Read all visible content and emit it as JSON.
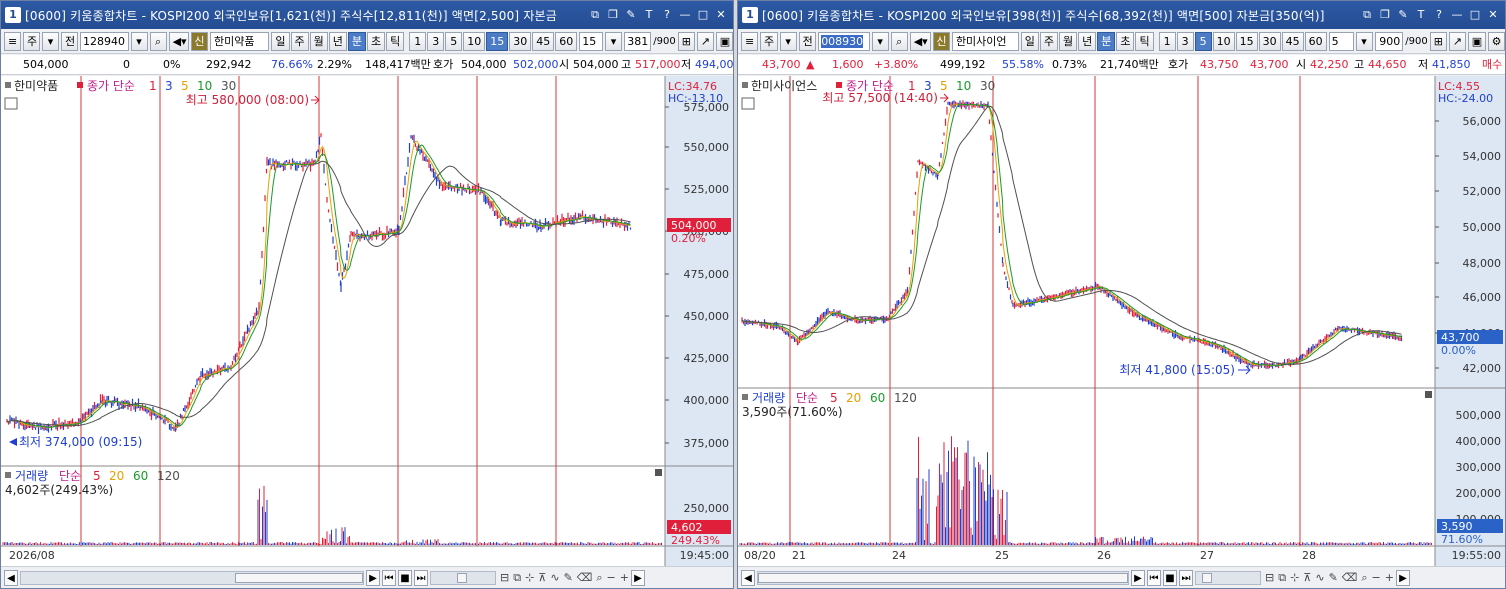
{
  "left": {
    "title": "[0600] 키움종합차트 - KOSPI200 외국인보유[1,621(천)] 주식수[12,811(천)] 액면[2,500] 자본금",
    "toolbar": {
      "market": "주",
      "prev": "전",
      "code": "128940",
      "badge": "신",
      "name": "한미약품",
      "periods": [
        "일",
        "주",
        "월",
        "년",
        "분",
        "초",
        "틱"
      ],
      "selected_period": "분",
      "intervals": [
        "1",
        "3",
        "5",
        "10",
        "15",
        "30",
        "45",
        "60"
      ],
      "selected_interval": "15",
      "interval_value": "15",
      "count": "381",
      "count_max": "/900"
    },
    "quote": {
      "price": "504,000",
      "change": "0",
      "change_pct": "0%",
      "volume": "292,942",
      "vol_ratio": "76.66%",
      "turnover": "2.29%",
      "amount": "148,417백만",
      "bid_label": "호가",
      "bid1": "504,000",
      "bid2": "502,000",
      "open_label": "시",
      "open": "504,000",
      "high_label": "고",
      "high": "517,000",
      "low_label": "저",
      "low": "494,000"
    },
    "chart": {
      "stock_label": "한미약품",
      "legend_prefix": "종가 단순",
      "legend_ma": [
        "1",
        "3",
        "5",
        "10",
        "30"
      ],
      "max_label": "최고 580,000 (08:00)",
      "min_label": "최저 374,000 (09:15)",
      "lc": "LC:34.76",
      "hc": "HC:-13.10",
      "price_ticks": [
        "575,000",
        "550,000",
        "525,000",
        "500,000",
        "475,000",
        "450,000",
        "425,000",
        "400,000",
        "375,000"
      ],
      "current_price": "504,000",
      "current_pct": "0.20%",
      "volume_label": "거래량",
      "volume_legend_prefix": "단순",
      "volume_ma": [
        "5",
        "20",
        "60",
        "120"
      ],
      "volume_info": "4,602주(249.43%)",
      "volume_tick": "250,000",
      "current_volume": "4,602",
      "current_volume_pct": "249.43%",
      "date_label": "2026/08",
      "time_label": "19:45:00"
    }
  },
  "right": {
    "title": "[0600] 키움종합차트 - KOSPI200 외국인보유[398(천)] 주식수[68,392(천)] 액면[500] 자본금[350(억)]",
    "toolbar": {
      "market": "주",
      "prev": "전",
      "code": "008930",
      "badge": "신",
      "name": "한미사이언",
      "periods": [
        "일",
        "주",
        "월",
        "년",
        "분",
        "초",
        "틱"
      ],
      "selected_period": "분",
      "intervals": [
        "1",
        "3",
        "5",
        "10",
        "15",
        "30",
        "45",
        "60"
      ],
      "selected_interval": "5",
      "interval_value": "5",
      "count": "900",
      "count_max": "/900"
    },
    "quote": {
      "price": "43,700",
      "change": "1,600",
      "change_pct": "+3.80%",
      "volume": "499,192",
      "vol_ratio": "55.58%",
      "turnover": "0.73%",
      "amount": "21,740백만",
      "bid_label": "호가",
      "bid1": "43,750",
      "bid2": "43,700",
      "open_label": "시",
      "open": "42,250",
      "high_label": "고",
      "high": "44,650",
      "low_label": "저",
      "low": "41,850",
      "extra": "매수"
    },
    "chart": {
      "stock_label": "한미사이언스",
      "legend_prefix": "종가 단순",
      "legend_ma": [
        "1",
        "3",
        "5",
        "10",
        "30"
      ],
      "max_label": "최고 57,500 (14:40)",
      "min_label": "최저 41,800 (15:05)",
      "lc": "LC:4.55",
      "hc": "HC:-24.00",
      "price_ticks": [
        "56,000",
        "54,000",
        "52,000",
        "50,000",
        "48,000",
        "46,000",
        "44,000",
        "42,000"
      ],
      "current_price": "43,700",
      "current_pct": "0.00%",
      "volume_label": "거래량",
      "volume_legend_prefix": "단순",
      "volume_ma": [
        "5",
        "20",
        "60",
        "120"
      ],
      "volume_info": "3,590주(71.60%)",
      "volume_ticks": [
        "500,000",
        "400,000",
        "300,000",
        "200,000",
        "100,000"
      ],
      "current_volume": "3,590",
      "current_volume_pct": "71.60%",
      "date_labels": [
        "08/20",
        "21",
        "24",
        "25",
        "26",
        "27",
        "28"
      ],
      "time_label": "19:55:00"
    }
  },
  "colors": {
    "titlebar": "#244c91",
    "up": "#e0203a",
    "down": "#1f3fd0",
    "ma1": "#e0203a",
    "ma3": "#1f3fd0",
    "ma5": "#e8a000",
    "ma10": "#1a9a2a",
    "ma30": "#505050",
    "price_box_left": "#e0203a",
    "price_box_right": "#2a62c8"
  }
}
